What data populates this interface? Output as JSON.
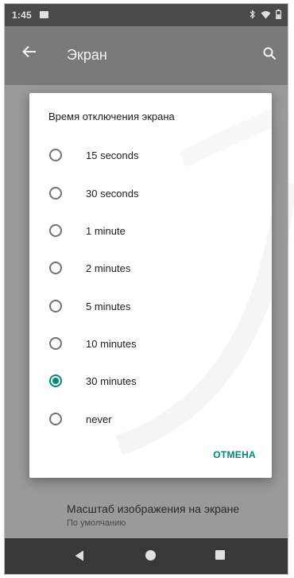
{
  "status_bar": {
    "time": "1:45"
  },
  "app_bar": {
    "title": "Экран"
  },
  "background": {
    "items": [
      {
        "title": "Масштаб изображения на экране",
        "summary": "По умолчанию"
      }
    ]
  },
  "dialog": {
    "title": "Время отключения экрана",
    "options": [
      {
        "label": "15 seconds",
        "selected": false
      },
      {
        "label": "30 seconds",
        "selected": false
      },
      {
        "label": "1 minute",
        "selected": false
      },
      {
        "label": "2 minutes",
        "selected": false
      },
      {
        "label": "5 minutes",
        "selected": false
      },
      {
        "label": "10 minutes",
        "selected": false
      },
      {
        "label": "30 minutes",
        "selected": true
      },
      {
        "label": "never",
        "selected": false
      }
    ],
    "cancel_label": "ОТМЕНА"
  },
  "colors": {
    "accent": "#00897b",
    "scrim": "#9a9a9a"
  }
}
